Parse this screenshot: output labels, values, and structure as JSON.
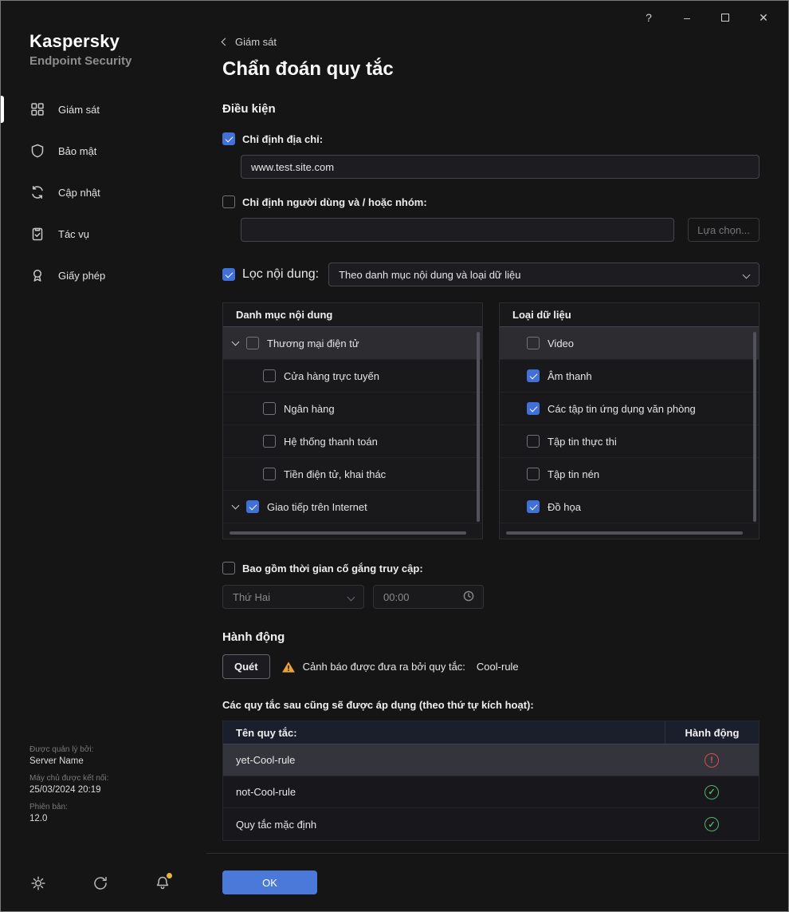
{
  "window": {
    "help": "?",
    "minimize": "–",
    "close": "✕"
  },
  "sidebar": {
    "brand_title": "Kaspersky",
    "brand_subtitle": "Endpoint Security",
    "items": [
      {
        "label": "Giám sát",
        "active": true
      },
      {
        "label": "Bảo mật",
        "active": false
      },
      {
        "label": "Cập nhật",
        "active": false
      },
      {
        "label": "Tác vụ",
        "active": false
      },
      {
        "label": "Giấy phép",
        "active": false
      }
    ],
    "info": {
      "managed_by_label": "Được quản lý bởi:",
      "managed_by_value": "Server Name",
      "connected_label": "Máy chủ được kết nối:",
      "connected_value": "25/03/2024 20:19",
      "version_label": "Phiên bản:",
      "version_value": "12.0"
    }
  },
  "main": {
    "breadcrumb": "Giám sát",
    "title": "Chẩn đoán quy tắc",
    "conditions_heading": "Điều kiện",
    "address": {
      "label": "Chỉ định địa chỉ:",
      "checked": true,
      "value": "www.test.site.com"
    },
    "users": {
      "label": "Chỉ định người dùng và / hoặc nhóm:",
      "checked": false,
      "value": "",
      "select_button": "Lựa chọn..."
    },
    "content_filter": {
      "label": "Lọc nội dung:",
      "checked": true,
      "selected_option": "Theo danh mục nội dung và loại dữ liệu"
    },
    "categories": {
      "header": "Danh mục nội dung",
      "items": [
        {
          "label": "Thương mại điện tử",
          "checked": false,
          "highlighted": true,
          "expandable": true
        },
        {
          "label": "Cửa hàng trực tuyến",
          "checked": false
        },
        {
          "label": "Ngân hàng",
          "checked": false
        },
        {
          "label": "Hệ thống thanh toán",
          "checked": false
        },
        {
          "label": "Tiền điện tử, khai thác",
          "checked": false
        },
        {
          "label": "Giao tiếp trên Internet",
          "checked": true,
          "expandable": true
        }
      ]
    },
    "data_types": {
      "header": "Loại dữ liệu",
      "items": [
        {
          "label": "Video",
          "checked": false,
          "highlighted": true
        },
        {
          "label": "Âm thanh",
          "checked": true
        },
        {
          "label": "Các tập tin ứng dụng văn phòng",
          "checked": true
        },
        {
          "label": "Tập tin thực thi",
          "checked": false
        },
        {
          "label": "Tập tin nén",
          "checked": false
        },
        {
          "label": "Đồ họa",
          "checked": true
        }
      ]
    },
    "time_filter": {
      "label": "Bao gồm thời gian cố gắng truy cập:",
      "checked": false,
      "day": "Thứ Hai",
      "time": "00:00"
    },
    "action_heading": "Hành động",
    "action": {
      "button": "Quét",
      "warning_text": "Cảnh báo được đưa ra bởi quy tắc:",
      "rule": "Cool-rule"
    },
    "rules": {
      "caption": "Các quy tắc sau cũng sẽ được áp dụng (theo thứ tự kích hoạt):",
      "col_name": "Tên quy tắc:",
      "col_action": "Hành động",
      "rows": [
        {
          "name": "yet-Cool-rule",
          "status": "warning",
          "selected": true
        },
        {
          "name": "not-Cool-rule",
          "status": "ok",
          "selected": false
        },
        {
          "name": "Quy tắc mặc định",
          "status": "ok",
          "selected": false
        }
      ]
    },
    "ok_button": "OK"
  }
}
